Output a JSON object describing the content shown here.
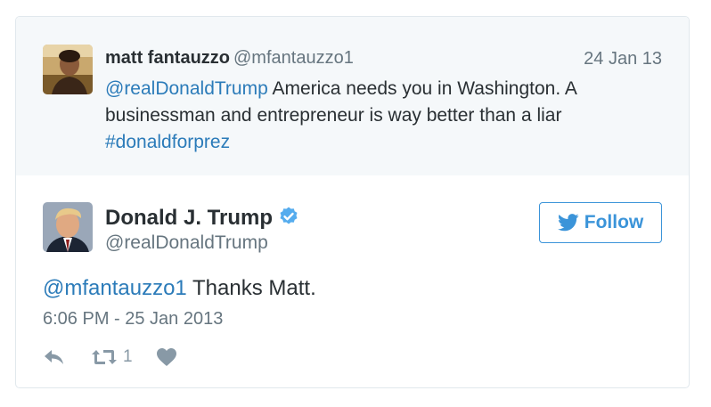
{
  "colors": {
    "link": "#2b7bb9",
    "follow": "#3b94d9",
    "verified": "#55acee",
    "muted": "#66757f",
    "parent_bg": "#f5f8fa"
  },
  "parent_tweet": {
    "author_name": "matt fantauzzo",
    "author_handle": "@mfantauzzo1",
    "date": "24 Jan 13",
    "mention": "@realDonaldTrump",
    "text": " America needs you in Washington. A businessman and entrepreneur is way better than a liar ",
    "hashtag": "#donaldforprez",
    "avatar_icon": "user-photo-avatar"
  },
  "tweet": {
    "author_name": "Donald J. Trump",
    "author_handle": "@realDonaldTrump",
    "verified_icon": "verified-badge-icon",
    "follow_label": "Follow",
    "mention": "@mfantauzzo1",
    "text": " Thanks Matt.",
    "timestamp": "6:06 PM - 25 Jan 2013",
    "retweet_count": "1",
    "avatar_icon": "user-photo-avatar"
  },
  "actions": {
    "reply_icon": "reply-icon",
    "retweet_icon": "retweet-icon",
    "like_icon": "heart-icon"
  }
}
